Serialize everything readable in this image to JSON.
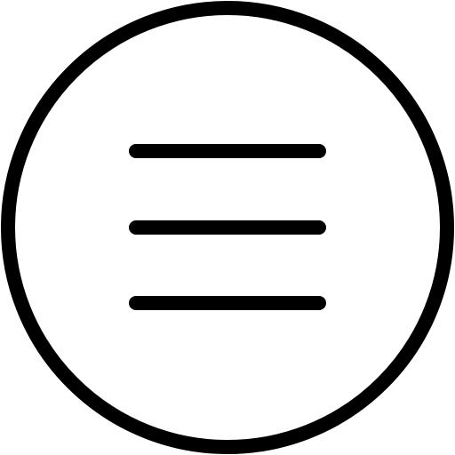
{
  "icon": {
    "name": "hamburger-menu-circle-icon",
    "stroke_color": "#000000",
    "background_color": "#ffffff"
  }
}
